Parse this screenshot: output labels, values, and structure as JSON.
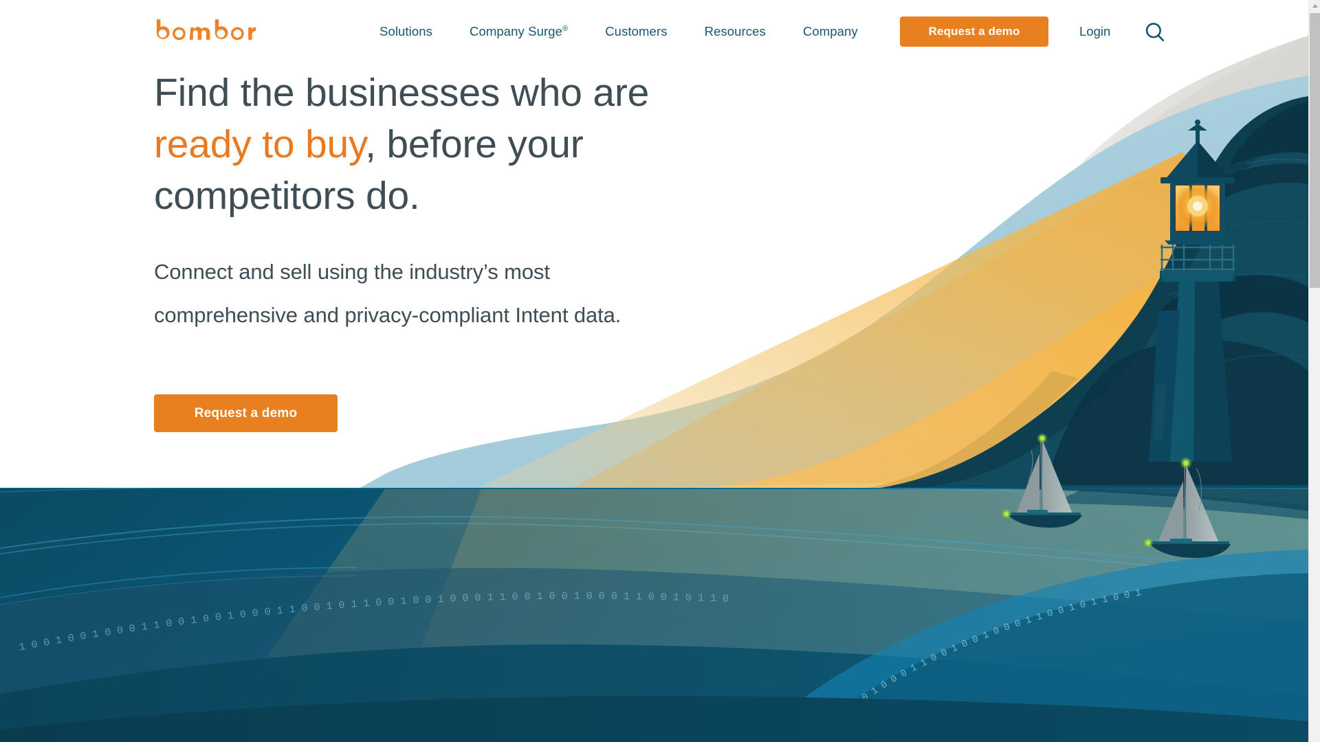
{
  "brand": {
    "name": "bombora",
    "accent_orange": "#e8801f",
    "accent_orange_text": "#ea7a21",
    "nav_text_color": "#1a5573",
    "heading_color": "#3f4d55",
    "ocean_deep": "#0a3d52",
    "ocean_mid": "#0d6e97",
    "sky_blue": "#a8cfdd",
    "beam_gold": "#efc172"
  },
  "nav": {
    "logo_label": "bombora",
    "links": [
      {
        "label": "Solutions",
        "sup": ""
      },
      {
        "label": "Company Surge",
        "sup": "®"
      },
      {
        "label": "Customers",
        "sup": ""
      },
      {
        "label": "Resources",
        "sup": ""
      },
      {
        "label": "Company",
        "sup": ""
      }
    ],
    "cta_label": "Request a demo",
    "login_label": "Login",
    "search_icon": "search-icon"
  },
  "hero": {
    "headline_part1": "Find the businesses who are ",
    "headline_accent": "ready to buy",
    "headline_part2": ", before your competitors do.",
    "subhead": "Connect and sell using the industry’s most comprehensive and privacy-compliant Intent data.",
    "cta_label": "Request a demo",
    "illustration": {
      "name": "lighthouse-ocean-illustration",
      "elements": [
        "lighthouse",
        "light-beam",
        "rocky-island",
        "sailboat-left",
        "sailboat-right",
        "ocean-waves",
        "binary-data-stream"
      ],
      "binary_stream": "1001001000110010010001100101100100100011001001000110010110"
    }
  },
  "scrollbar": {
    "up_arrow_icon": "chevron-up-icon",
    "thumb_label": "vertical-scroll-thumb"
  }
}
